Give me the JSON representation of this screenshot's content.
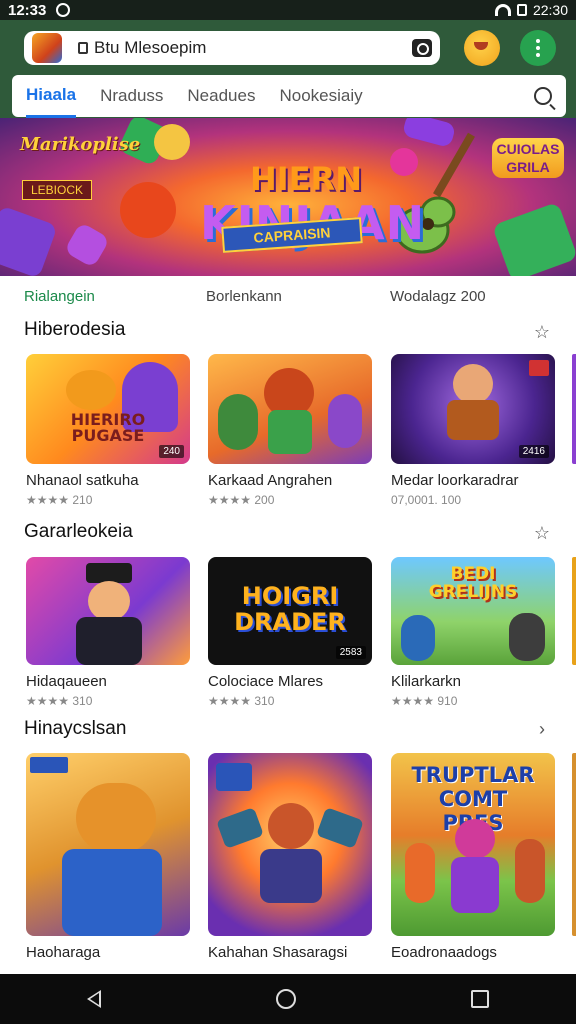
{
  "status_bar": {
    "time": "12:33",
    "right_time": "22:30"
  },
  "search": {
    "query": "Btu Mlesoepim"
  },
  "tabs": [
    {
      "label": "Hiaala",
      "active": true
    },
    {
      "label": "Nraduss",
      "active": false
    },
    {
      "label": "Neadues",
      "active": false
    },
    {
      "label": "Nookesiaiy",
      "active": false
    }
  ],
  "banner": {
    "logo_left": "Marikoplise",
    "badge_left": "LEBIOCK",
    "title_line1": "HIERN",
    "title_line2": "KINJAAN",
    "ribbon": "CAPRAISIN",
    "logo_right": "CUIOLAS GRILA"
  },
  "info_strip": [
    "Rialangein",
    "Borlenkann",
    "Wodalagz 200"
  ],
  "sections": [
    {
      "title": "Hiberodesia",
      "action_icon": "star-outline-icon",
      "apps": [
        {
          "name": "Nhanaol satkuha",
          "meta": "★★★★ 210",
          "art": "HIERIRO PUGASE",
          "chip": "240"
        },
        {
          "name": "Karkaad Angrahen",
          "meta": "★★★★ 200",
          "art": "",
          "chip": ""
        },
        {
          "name": "Medar loorkaradrar",
          "meta": "07,0001. 100",
          "art": "",
          "chip": "2416"
        }
      ]
    },
    {
      "title": "Gararleokeia",
      "action_icon": "star-outline-icon",
      "apps": [
        {
          "name": "Hidaqaueen",
          "meta": "★★★★ 310",
          "art": "",
          "chip": ""
        },
        {
          "name": "Colociace Mlares",
          "meta": "★★★★ 310",
          "art": "HOIGRI DRADER",
          "chip": "2583"
        },
        {
          "name": "Klilarkarkn",
          "meta": "★★★★ 910",
          "art": "BEDI GRELIJNS",
          "chip": ""
        }
      ]
    },
    {
      "title": "Hinaycslsan",
      "action_icon": "chevron-right-icon",
      "apps": [
        {
          "name": "Haoharaga",
          "meta": "",
          "art": "",
          "chip": ""
        },
        {
          "name": "Kahahan Shasaragsi",
          "meta": "",
          "art": "",
          "chip": ""
        },
        {
          "name": "Eoadronaadogs",
          "meta": "",
          "art": "TRUPTLAR COMT PRES",
          "chip": ""
        }
      ]
    }
  ],
  "colors": {
    "accent": "#1a73e8",
    "header": "#2f5a3a",
    "menu_button": "#27a24f"
  }
}
